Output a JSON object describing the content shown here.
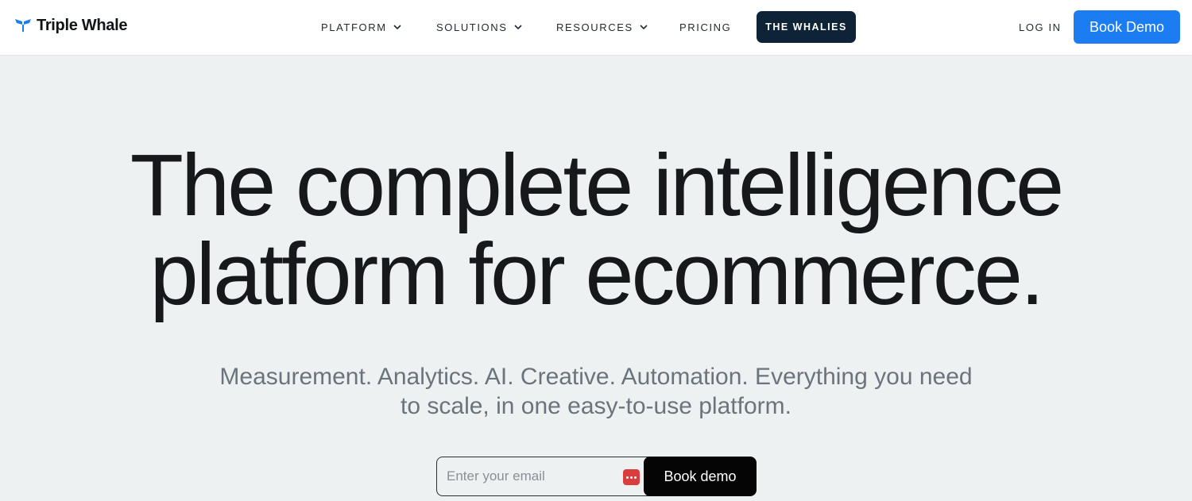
{
  "header": {
    "logo": {
      "text": "Triple Whale",
      "icon": "whale-tail-icon",
      "color": "#1c7df3"
    },
    "nav": [
      {
        "label": "PLATFORM",
        "has_dropdown": true
      },
      {
        "label": "SOLUTIONS",
        "has_dropdown": true
      },
      {
        "label": "RESOURCES",
        "has_dropdown": true
      },
      {
        "label": "PRICING",
        "has_dropdown": false
      }
    ],
    "whalies_label": "THE WHALIES",
    "login_label": "LOG IN",
    "book_demo_label": "Book Demo"
  },
  "hero": {
    "headline_lines": [
      "The complete intelligence",
      "platform for ecommerce."
    ],
    "subheadline_lines": [
      "Measurement. Analytics. AI. Creative. Automation. Everything you need",
      "to scale, in one easy-to-use platform."
    ]
  },
  "email_form": {
    "placeholder": "Enter your email",
    "value": "",
    "password_manager_icon": "password-manager-icon",
    "submit_label": "Book demo"
  },
  "colors": {
    "accent": "#1c7df3",
    "whalies_bg": "#0e2436",
    "page_bg": "#eef1f2",
    "submit_bg": "#050505"
  }
}
